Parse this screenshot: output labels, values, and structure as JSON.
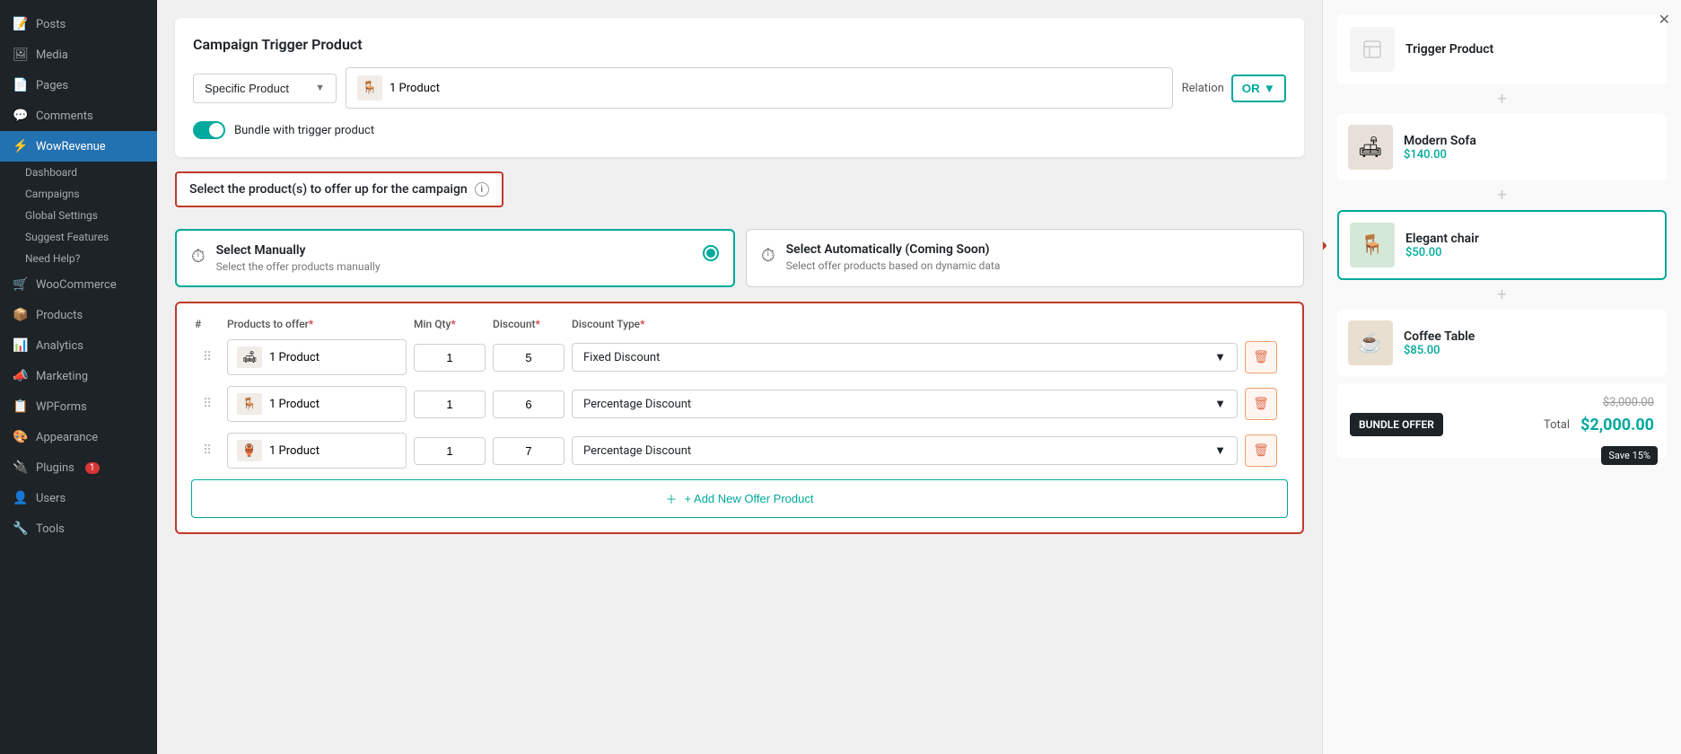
{
  "sidebar": {
    "items": [
      {
        "label": "Posts",
        "icon": "📝",
        "active": false
      },
      {
        "label": "Media",
        "icon": "🖼",
        "active": false
      },
      {
        "label": "Pages",
        "icon": "📄",
        "active": false
      },
      {
        "label": "Comments",
        "icon": "💬",
        "active": false
      },
      {
        "label": "WowRevenue",
        "icon": "⚡",
        "active": true
      },
      {
        "label": "Dashboard",
        "sub": true
      },
      {
        "label": "Campaigns",
        "sub": true
      },
      {
        "label": "Global Settings",
        "sub": true
      },
      {
        "label": "Suggest Features",
        "sub": true
      },
      {
        "label": "Need Help?",
        "sub": true
      },
      {
        "label": "WooCommerce",
        "icon": "🛒",
        "active": false
      },
      {
        "label": "Products",
        "icon": "📦",
        "active": false
      },
      {
        "label": "Analytics",
        "icon": "📊",
        "active": false
      },
      {
        "label": "Marketing",
        "icon": "📣",
        "active": false
      },
      {
        "label": "WPForms",
        "icon": "📋",
        "active": false
      },
      {
        "label": "Appearance",
        "icon": "🎨",
        "active": false
      },
      {
        "label": "Plugins",
        "icon": "🔌",
        "active": false,
        "badge": "1"
      },
      {
        "label": "Users",
        "icon": "👤",
        "active": false
      },
      {
        "label": "Tools",
        "icon": "🔧",
        "active": false
      }
    ]
  },
  "trigger": {
    "title": "Campaign Trigger Product",
    "dropdown_label": "Specific Product",
    "product_label": "1 Product",
    "relation_label": "Relation",
    "or_label": "OR",
    "bundle_label": "Bundle with trigger product"
  },
  "select_section": {
    "title": "Select the product(s) to offer up for the campaign",
    "manually": {
      "title": "Select Manually",
      "desc": "Select the offer products manually"
    },
    "automatically": {
      "title": "Select Automatically (Coming Soon)",
      "desc": "Select offer products based on dynamic data"
    }
  },
  "table": {
    "headers": {
      "hash": "#",
      "products": "Products to offer",
      "min_qty": "Min Qty",
      "discount": "Discount",
      "discount_type": "Discount Type"
    },
    "rows": [
      {
        "product": "1 Product",
        "icon": "🛋",
        "qty": "1",
        "discount": "5",
        "discount_type": "Fixed Discount"
      },
      {
        "product": "1 Product",
        "icon": "🪑",
        "qty": "1",
        "discount": "6",
        "discount_type": "Percentage Discount"
      },
      {
        "product": "1 Product",
        "icon": "🏺",
        "qty": "1",
        "discount": "7",
        "discount_type": "Percentage Discount"
      }
    ],
    "add_button": "+ Add New Offer Product"
  },
  "right_panel": {
    "trigger_product": {
      "title": "Trigger Product"
    },
    "offer_products": [
      {
        "name": "Modern Sofa",
        "price": "$140.00",
        "icon": "🛋"
      },
      {
        "name": "Elegant chair",
        "price": "$50.00",
        "icon": "🪑"
      },
      {
        "name": "Coffee Table",
        "price": "$85.00",
        "icon": "☕"
      }
    ],
    "footer": {
      "badge": "BUNDLE OFFER",
      "total_label": "Total",
      "original_price": "$3,000.00",
      "discounted_price": "$2,000.00",
      "save_badge": "Save 15%"
    }
  }
}
